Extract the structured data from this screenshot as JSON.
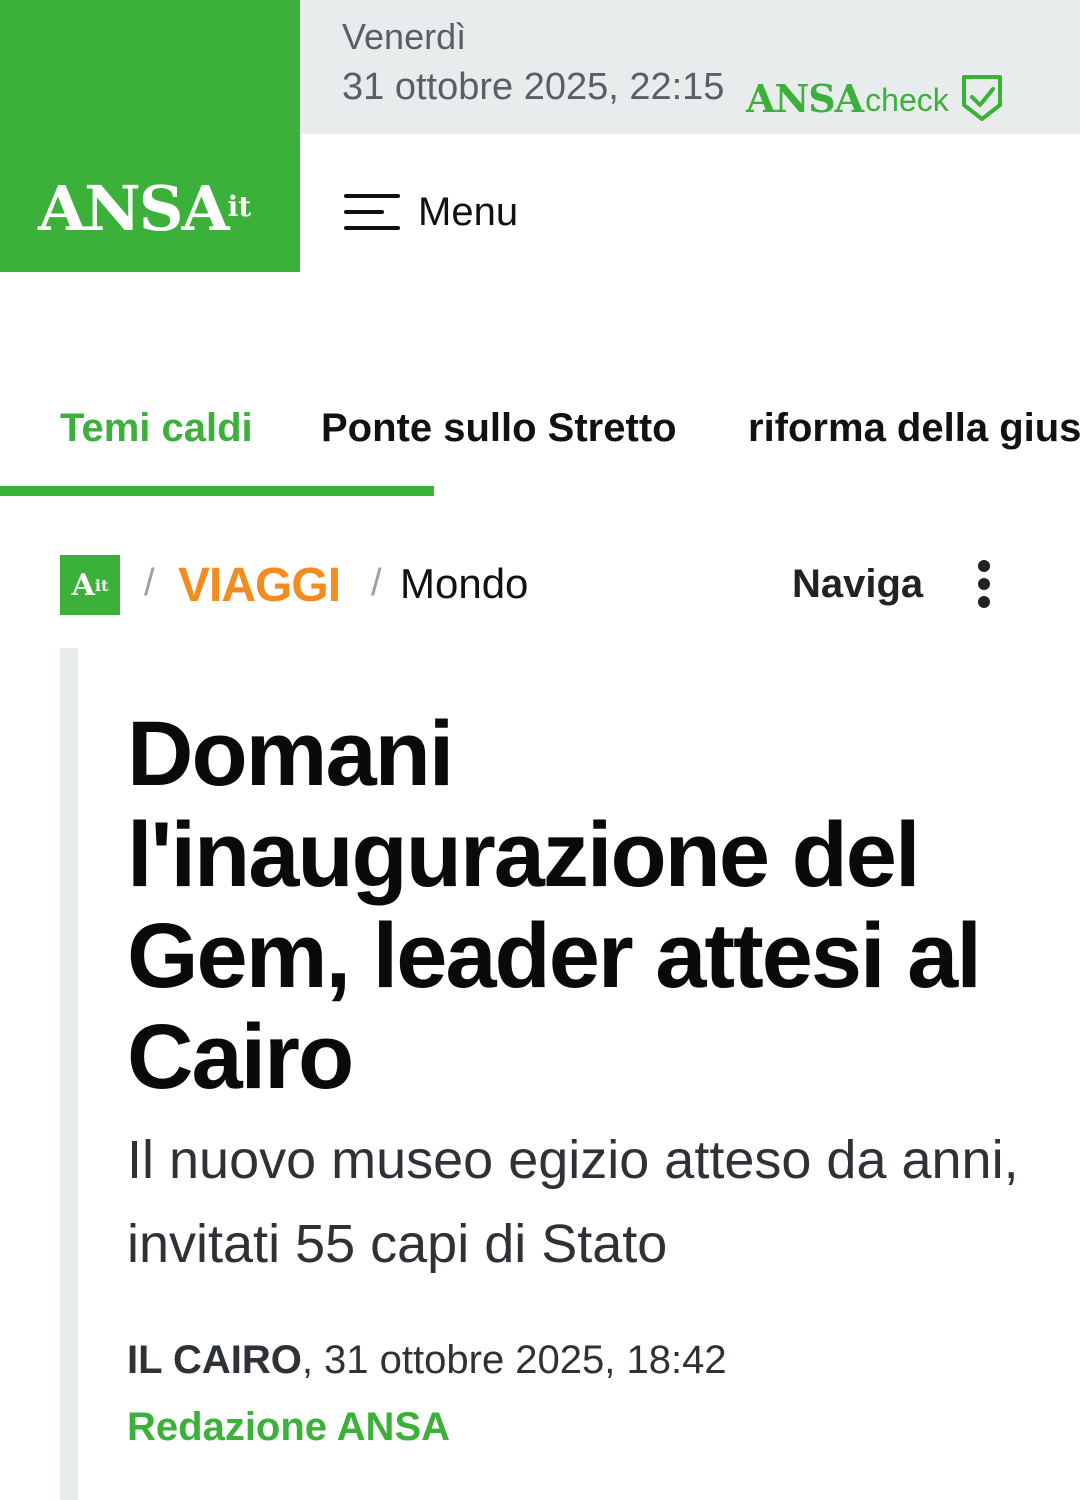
{
  "header": {
    "logo_main": "ANSA",
    "logo_suffix": "it",
    "day": "Venerdì",
    "datetime": "31 ottobre 2025, 22:15",
    "check_brand": "ANSA",
    "check_word": "check",
    "menu_label": "Menu"
  },
  "topics": {
    "items": [
      {
        "label": "Temi caldi"
      },
      {
        "label": "Ponte sullo Stretto"
      },
      {
        "label": "riforma della gius"
      }
    ]
  },
  "breadcrumb": {
    "logo": "A",
    "logo_suffix": "it",
    "separator": "/",
    "section": "VIAGGI",
    "subsection": "Mondo",
    "navigate_label": "Naviga"
  },
  "article": {
    "headline": "Domani l'inaugurazione del Gem, leader attesi al Cairo",
    "subheadline": "Il nuovo museo egizio atteso da anni, invitati 55 capi di Stato",
    "place": "IL CAIRO",
    "date": ", 31 ottobre 2025, 18:42",
    "author": "Redazione ANSA"
  },
  "colors": {
    "brand_green": "#3cb13a",
    "section_orange": "#f28c1e",
    "date_bar_bg": "#e8ecec"
  }
}
